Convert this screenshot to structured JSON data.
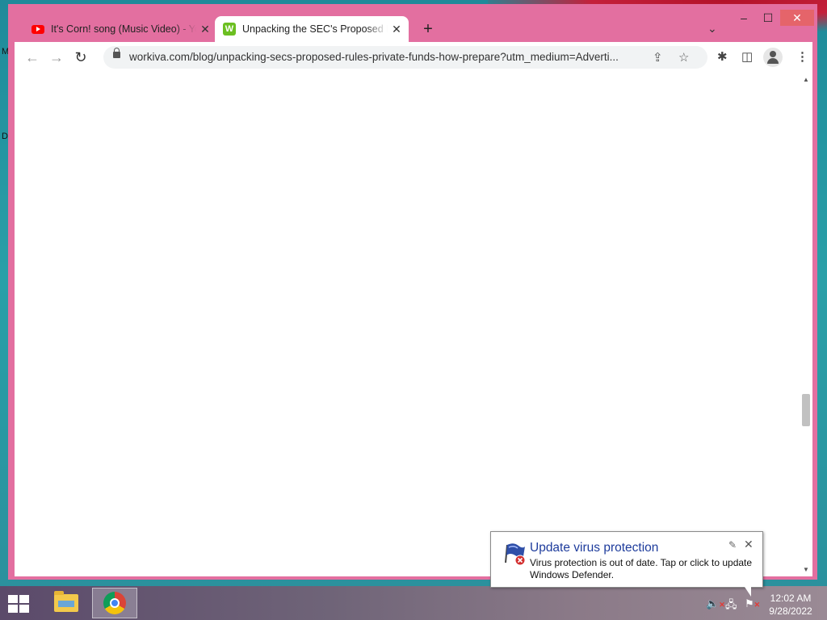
{
  "desktop": {
    "edge_glyph_1": "M",
    "edge_glyph_2": "D"
  },
  "window_controls": {
    "minimize": "–",
    "maximize": "☐",
    "close": "✕"
  },
  "tabs": [
    {
      "title": "It's Corn! song (Music Video) - YouTube",
      "icon": "youtube-icon",
      "close": "✕"
    },
    {
      "title": "Unpacking the SEC's Proposed Rules",
      "icon": "workiva-icon",
      "icon_text": "W",
      "close": "✕"
    }
  ],
  "new_tab": "+",
  "tab_search": "⌄",
  "toolbar": {
    "back": "←",
    "forward": "→",
    "reload": "↻",
    "url": "workiva.com/blog/unpacking-secs-proposed-rules-private-funds-how-prepare?utm_medium=Adverti...",
    "share": "⇪",
    "bookmark": "☆",
    "extensions": "✱",
    "side_panel": "◫",
    "menu": "⋮"
  },
  "scrollbar": {
    "up": "▲",
    "down": "▼",
    "position_fraction": 0.66
  },
  "taskbar": {
    "apps": [
      "file-explorer",
      "google-chrome"
    ],
    "volume": "🔈",
    "network": "🖧",
    "action_center": "⚑",
    "time": "12:02 AM",
    "date": "9/28/2022"
  },
  "notification": {
    "title": "Update virus protection",
    "body": "Virus protection is out of date. Tap or click to update Windows Defender.",
    "settings": "✎",
    "close": "✕"
  },
  "colors": {
    "window_frame": "#e36fa0",
    "close_button": "#e5646a",
    "notification_title": "#1e3c9c"
  }
}
